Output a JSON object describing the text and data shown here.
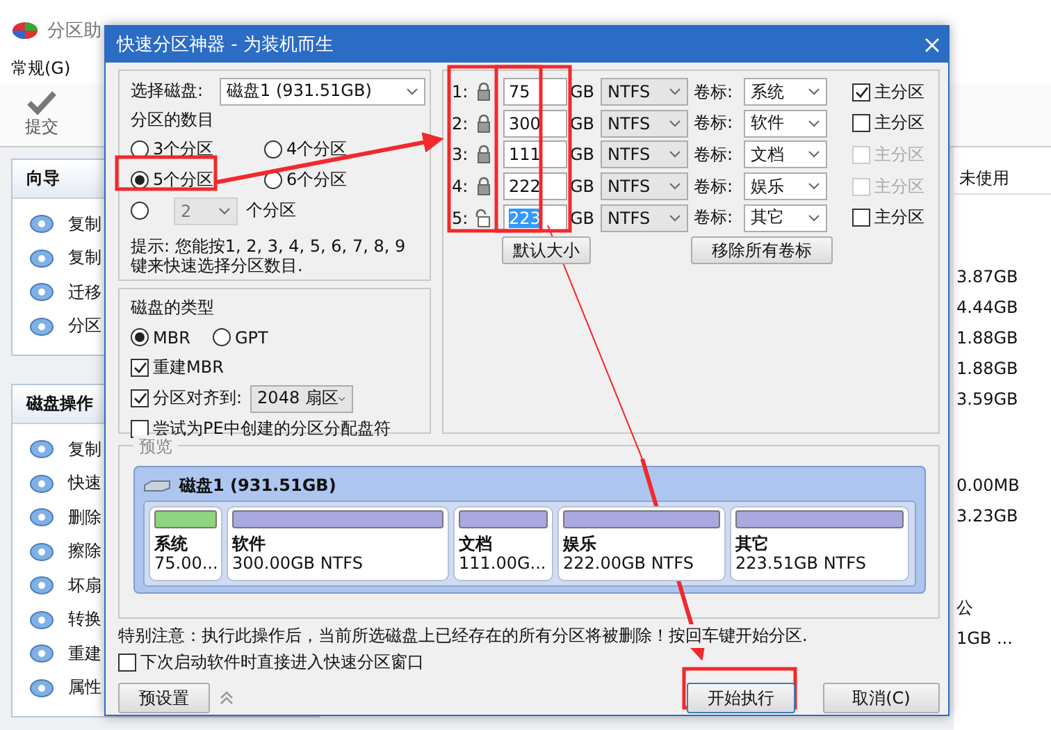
{
  "app": {
    "title": "分区助",
    "menu": [
      {
        "label": "常规(G)"
      }
    ],
    "toolbar": [
      {
        "label": "提交"
      }
    ],
    "wizard": {
      "title": "向导",
      "items": [
        "复制",
        "复制",
        "迁移",
        "分区"
      ]
    },
    "disk_ops": {
      "title": "磁盘操作",
      "items": [
        "复制",
        "快速",
        "删除",
        "擦除",
        "坏扇",
        "转换",
        "重建",
        "属性"
      ]
    },
    "right_column": {
      "header": "未使用",
      "cells": [
        "3.87GB",
        "4.44GB",
        "1.88GB",
        "1.88GB",
        "3.59GB",
        "0.00MB",
        "3.23GB",
        "公",
        "1GB ..."
      ]
    }
  },
  "dialog": {
    "title": "快速分区神器 - 为装机而生",
    "disk_select": {
      "label": "选择磁盘:",
      "value": "磁盘1 (931.51GB)"
    },
    "count": {
      "label": "分区的数目",
      "options": [
        {
          "label": "3个分区",
          "selected": false
        },
        {
          "label": "4个分区",
          "selected": false
        },
        {
          "label": "5个分区",
          "selected": true
        },
        {
          "label": "6个分区",
          "selected": false
        }
      ],
      "custom": {
        "selected": false,
        "disabled": true,
        "value": "2",
        "label": "个分区"
      }
    },
    "hint": "提示: 您能按1, 2, 3, 4, 5, 6, 7, 8, 9键来快速选择分区数目.",
    "disk_type": {
      "label": "磁盘的类型",
      "options": [
        {
          "label": "MBR",
          "selected": true
        },
        {
          "label": "GPT",
          "selected": false
        }
      ]
    },
    "options": [
      {
        "kind": "check",
        "label": "重建MBR",
        "checked": true
      },
      {
        "kind": "align",
        "label": "分区对齐到:",
        "checked": true,
        "value": "2048 扇区"
      },
      {
        "kind": "check",
        "label": "尝试为PE中创建的分区分配盘符",
        "checked": false
      }
    ],
    "partitions": [
      {
        "number": "1:",
        "locked": true,
        "size": "75",
        "selected": false,
        "unit": "GB",
        "fs": "NTFS",
        "caption": "卷标:",
        "label": "系统",
        "primary": {
          "label": "主分区",
          "checked": true,
          "disabled": false
        }
      },
      {
        "number": "2:",
        "locked": true,
        "size": "300",
        "selected": false,
        "unit": "GB",
        "fs": "NTFS",
        "caption": "卷标:",
        "label": "软件",
        "primary": {
          "label": "主分区",
          "checked": false,
          "disabled": false
        }
      },
      {
        "number": "3:",
        "locked": true,
        "size": "111",
        "selected": false,
        "unit": "GB",
        "fs": "NTFS",
        "caption": "卷标:",
        "label": "文档",
        "primary": {
          "label": "主分区",
          "checked": false,
          "disabled": true
        }
      },
      {
        "number": "4:",
        "locked": true,
        "size": "222",
        "selected": false,
        "unit": "GB",
        "fs": "NTFS",
        "caption": "卷标:",
        "label": "娱乐",
        "primary": {
          "label": "主分区",
          "checked": false,
          "disabled": true
        }
      },
      {
        "number": "5:",
        "locked": false,
        "size": "223",
        "selected": true,
        "unit": "GB",
        "fs": "NTFS",
        "caption": "卷标:",
        "label": "其它",
        "primary": {
          "label": "主分区",
          "checked": false,
          "disabled": false
        }
      }
    ],
    "default_size_button": "默认大小",
    "clear_labels_button": "移除所有卷标",
    "preview": {
      "title": "预览",
      "disk": "磁盘1 (931.51GB)",
      "partitions": [
        {
          "name": "系统",
          "detail": "75.00...",
          "color": "#8fd47f"
        },
        {
          "name": "软件",
          "detail": "300.00GB NTFS",
          "color": "#a9a9e0"
        },
        {
          "name": "文档",
          "detail": "111.00G...",
          "color": "#a9a9e0"
        },
        {
          "name": "娱乐",
          "detail": "222.00GB NTFS",
          "color": "#a9a9e0"
        },
        {
          "name": "其它",
          "detail": "223.51GB NTFS",
          "color": "#a9a9e0"
        }
      ]
    },
    "warning": "特别注意：执行此操作后，当前所选磁盘上已经存在的所有分区将被删除！按回车键开始分区.",
    "startup_option": {
      "label": "下次启动软件时直接进入快速分区窗口",
      "checked": false
    },
    "buttons": [
      {
        "kind": "preset",
        "label": "预设置"
      },
      {
        "kind": "start",
        "label": "开始执行"
      },
      {
        "kind": "cancel",
        "label": "取消(C)"
      }
    ]
  }
}
